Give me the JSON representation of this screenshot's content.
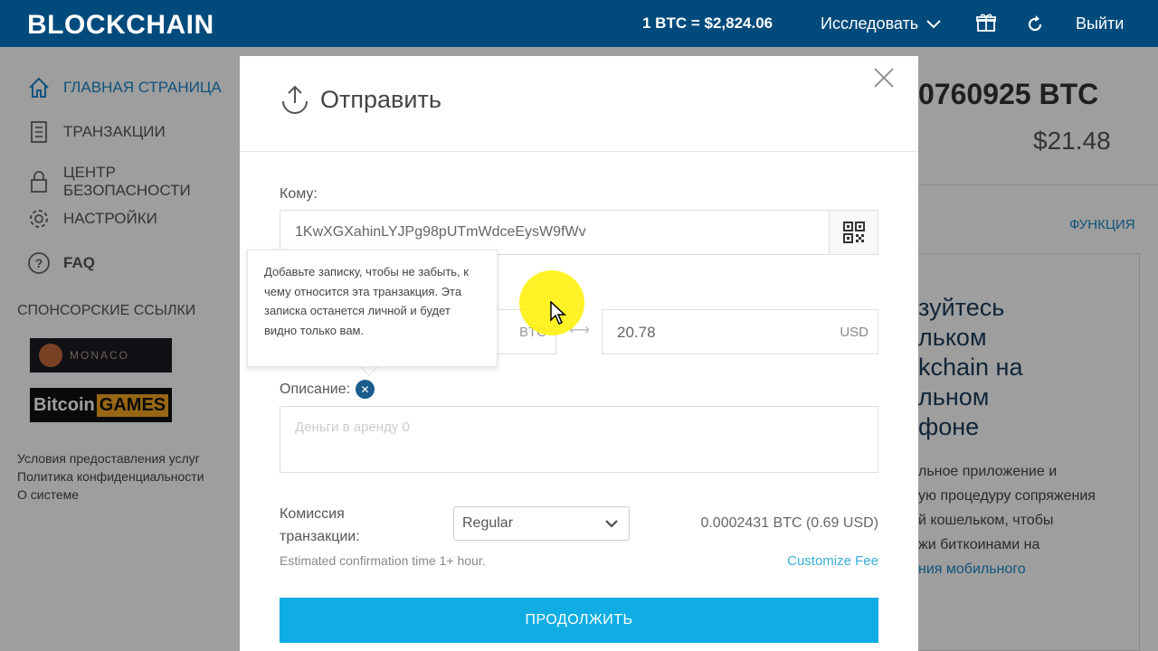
{
  "topbar": {
    "logo": "BLOCKCHAIN",
    "price": "1 BTC = $2,824.06",
    "explore": "Исследовать",
    "logout": "Выйти"
  },
  "sidebar": {
    "items": [
      {
        "label": "ГЛАВНАЯ СТРАНИЦА"
      },
      {
        "label": "ТРАНЗАКЦИИ"
      },
      {
        "label": "ЦЕНТР БЕЗОПАСНОСТИ"
      },
      {
        "label": "НАСТРОЙКИ"
      },
      {
        "label": "FAQ"
      }
    ],
    "sponsor_title": "СПОНСОРСКИЕ ССЫЛКИ",
    "sponsor_monaco": "MONACO",
    "sponsor_bitcoin": "Bitcoin",
    "sponsor_games": "GAMES",
    "footer": [
      "Условия предоставления услуг",
      "Политика конфиденциальности",
      "О системе"
    ]
  },
  "right_panel": {
    "balance": "0760925 BTC",
    "balance_usd": "$21.48",
    "func": "ФУНКЦИЯ",
    "promo_heading": [
      "зуйтесь",
      "льком",
      "kchain на",
      "льном",
      "фоне"
    ],
    "promo_text": [
      "льное приложение и",
      "ую процедуру сопряжения",
      "й кошельком, чтобы",
      "жи биткоинами на"
    ],
    "promo_link": "ния мобильного"
  },
  "modal": {
    "title": "Отправить",
    "to_label": "Кому:",
    "address": "1KwXGXahinLYJPg98pUTmWdceEysW9fWv",
    "btc_unit": "BTC",
    "usd_value": "20.78",
    "usd_unit": "USD",
    "desc_label": "Описание:",
    "desc_placeholder": "Деньги в аренду 0",
    "fee_label": [
      "Комиссия",
      "транзакции:"
    ],
    "fee_option": "Regular",
    "fee_amount": "0.0002431 BTC (0.69 USD)",
    "est_time": "Estimated confirmation time 1+ hour.",
    "customize_fee": "Customize Fee",
    "continue": "ПРОДОЛЖИТЬ"
  },
  "tooltip": {
    "text": "Добавьте записку, чтобы не забыть, к чему относится эта транзакция. Эта записка останется личной и будет видно только вам."
  },
  "colors": {
    "topbar": "#004a7c",
    "accent": "#10ade4",
    "link": "#1a86c8"
  }
}
